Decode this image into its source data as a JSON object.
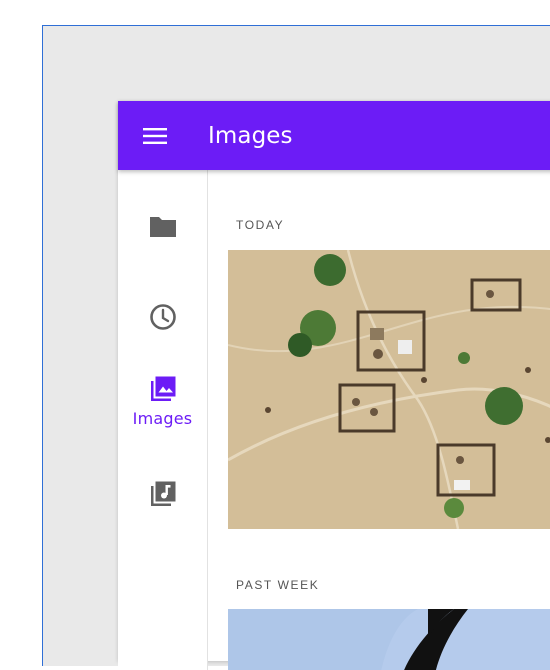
{
  "app_bar": {
    "title": "Images",
    "menu_icon": "menu-icon",
    "background": "#6c1cf6"
  },
  "nav_rail": {
    "items": [
      {
        "icon": "folder-icon",
        "label": "",
        "selected": false
      },
      {
        "icon": "clock-icon",
        "label": "",
        "selected": false
      },
      {
        "icon": "image-library-icon",
        "label": "Images",
        "selected": true
      },
      {
        "icon": "music-library-icon",
        "label": "",
        "selected": false
      }
    ],
    "selected_color": "#6c1cf6",
    "icon_color": "#616161"
  },
  "content": {
    "sections": [
      {
        "label": "TODAY",
        "image": "aerial-village-photo"
      },
      {
        "label": "PAST WEEK",
        "image": "sky-silhouette-photo"
      }
    ]
  }
}
